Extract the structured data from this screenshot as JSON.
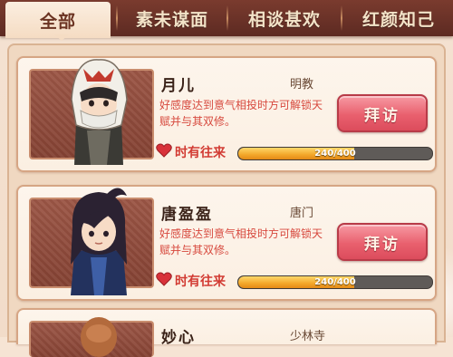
{
  "tabs": [
    {
      "label": "全部",
      "active": true
    },
    {
      "label": "素未谋面",
      "active": false
    },
    {
      "label": "相谈甚欢",
      "active": false
    },
    {
      "label": "红颜知己",
      "active": false
    }
  ],
  "characters": [
    {
      "name": "月儿",
      "sect": "明教",
      "description": "好感度达到意气相投时方可解锁天赋并与其双修。",
      "button_label": "拜访",
      "bond_level": "时有往来",
      "progress_text": "240/400",
      "progress": 0.6
    },
    {
      "name": "唐盈盈",
      "sect": "唐门",
      "description": "好感度达到意气相投时方可解锁天赋并与其双修。",
      "button_label": "拜访",
      "bond_level": "时有往来",
      "progress_text": "240/400",
      "progress": 0.6
    },
    {
      "name": "妙心",
      "sect": "少林寺"
    }
  ],
  "colors": {
    "tab_bar": "#6b3127",
    "visit_button": "#e9606e",
    "progress_fill": "#f3a72a",
    "bond_text": "#d23b33"
  }
}
